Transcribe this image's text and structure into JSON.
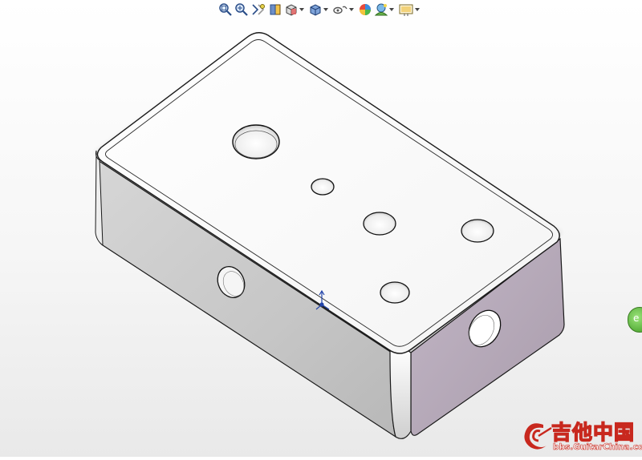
{
  "toolbar": {
    "items": [
      {
        "name": "zoom-to-fit-icon"
      },
      {
        "name": "zoom-to-area-icon"
      },
      {
        "name": "previous-view-icon"
      },
      {
        "name": "section-view-icon"
      },
      {
        "name": "view-orientation-icon",
        "dropdown": true
      },
      {
        "name": "display-style-icon",
        "dropdown": true
      },
      {
        "name": "hide-show-items-icon",
        "dropdown": true
      },
      {
        "name": "edit-appearance-icon"
      },
      {
        "name": "apply-scene-icon",
        "dropdown": true
      },
      {
        "name": "view-settings-icon",
        "dropdown": true
      }
    ]
  },
  "model": {
    "name": "enclosure box",
    "top_holes": 5,
    "front_holes": 1,
    "right_holes": 1,
    "colors": {
      "top_face": "#fdfdfd",
      "front_face": "#c9c9c9",
      "right_face": "#b7aabb",
      "edge": "#1a1a1a",
      "triad": "#2244aa"
    }
  },
  "side_tab": {
    "label": "e",
    "color": "#4caf29"
  },
  "watermark": {
    "title": "吉他中国",
    "url": "bbs.GuitarChina.com",
    "color": "#c8281e"
  }
}
